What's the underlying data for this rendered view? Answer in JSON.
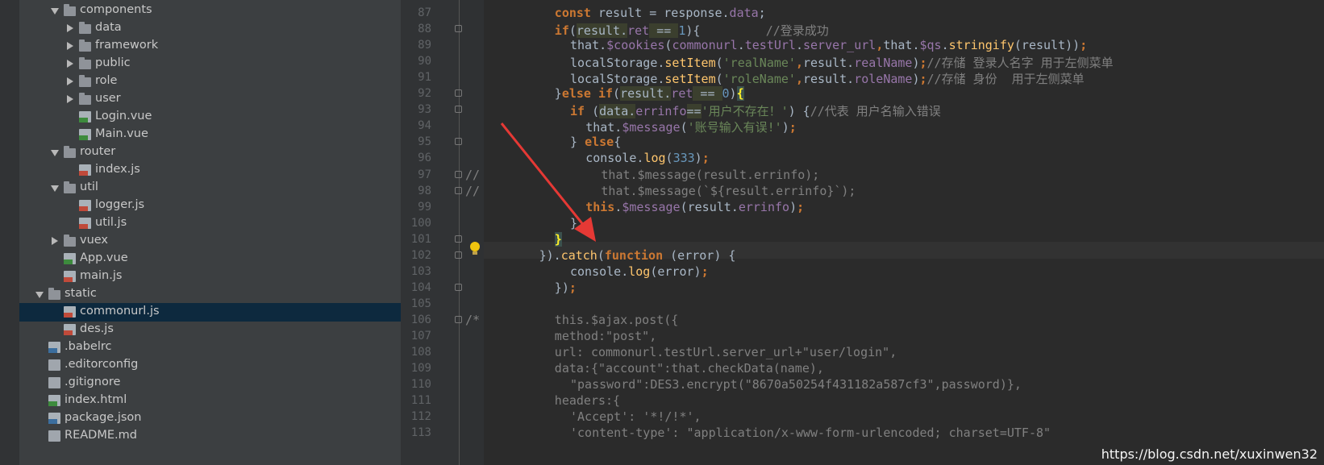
{
  "tree": {
    "items": [
      {
        "label": "components",
        "icon": "folder",
        "indent": 2,
        "expanded": true
      },
      {
        "label": "data",
        "icon": "folder",
        "indent": 3,
        "expanded": false
      },
      {
        "label": "framework",
        "icon": "folder",
        "indent": 3,
        "expanded": false
      },
      {
        "label": "public",
        "icon": "folder",
        "indent": 3,
        "expanded": false
      },
      {
        "label": "role",
        "icon": "folder",
        "indent": 3,
        "expanded": false
      },
      {
        "label": "user",
        "icon": "folder",
        "indent": 3,
        "expanded": false
      },
      {
        "label": "Login.vue",
        "icon": "vue",
        "indent": 3
      },
      {
        "label": "Main.vue",
        "icon": "vue",
        "indent": 3
      },
      {
        "label": "router",
        "icon": "folder",
        "indent": 2,
        "expanded": true
      },
      {
        "label": "index.js",
        "icon": "js",
        "indent": 3
      },
      {
        "label": "util",
        "icon": "folder",
        "indent": 2,
        "expanded": true
      },
      {
        "label": "logger.js",
        "icon": "js",
        "indent": 3
      },
      {
        "label": "util.js",
        "icon": "js",
        "indent": 3
      },
      {
        "label": "vuex",
        "icon": "folder",
        "indent": 2,
        "expanded": false
      },
      {
        "label": "App.vue",
        "icon": "vue",
        "indent": 2
      },
      {
        "label": "main.js",
        "icon": "js",
        "indent": 2
      },
      {
        "label": "static",
        "icon": "folder",
        "indent": 1,
        "expanded": true
      },
      {
        "label": "commonurl.js",
        "icon": "js",
        "indent": 2,
        "selected": true
      },
      {
        "label": "des.js",
        "icon": "js",
        "indent": 2
      },
      {
        "label": ".babelrc",
        "icon": "json",
        "indent": 1
      },
      {
        "label": ".editorconfig",
        "icon": "txt",
        "indent": 1
      },
      {
        "label": ".gitignore",
        "icon": "txt",
        "indent": 1
      },
      {
        "label": "index.html",
        "icon": "html",
        "indent": 1
      },
      {
        "label": "package.json",
        "icon": "json",
        "indent": 1
      },
      {
        "label": "README.md",
        "icon": "txt",
        "indent": 1
      }
    ]
  },
  "editor": {
    "lines": [
      {
        "n": "87",
        "fold": false,
        "prefix": "",
        "indent": 4,
        "tokens": [
          [
            "k",
            "const"
          ],
          [
            "t",
            " result = response."
          ],
          [
            "p",
            "data"
          ],
          [
            "t",
            ";"
          ]
        ]
      },
      {
        "n": "88",
        "fold": true,
        "prefix": "",
        "indent": 4,
        "tokens": [
          [
            "k",
            "if"
          ],
          [
            "t",
            "("
          ],
          [
            "hl",
            "result."
          ],
          [
            "p",
            "ret"
          ],
          [
            "hl",
            " == "
          ],
          [
            "n",
            "1"
          ],
          [
            "t",
            "){         "
          ],
          [
            "c",
            "//登录成功"
          ]
        ]
      },
      {
        "n": "89",
        "fold": false,
        "prefix": "",
        "indent": 5,
        "tokens": [
          [
            "t",
            "that."
          ],
          [
            "p",
            "$cookies"
          ],
          [
            "t",
            "("
          ],
          [
            "p",
            "commonurl"
          ],
          [
            "t",
            "."
          ],
          [
            "p",
            "testUrl"
          ],
          [
            "t",
            "."
          ],
          [
            "p",
            "server_url"
          ],
          [
            "k",
            ","
          ],
          [
            "t",
            "that."
          ],
          [
            "p",
            "$qs"
          ],
          [
            "t",
            "."
          ],
          [
            "f",
            "stringify"
          ],
          [
            "t",
            "(result))"
          ],
          [
            "k",
            ";"
          ]
        ]
      },
      {
        "n": "90",
        "fold": false,
        "prefix": "",
        "indent": 5,
        "tokens": [
          [
            "t",
            "localStorage."
          ],
          [
            "f",
            "setItem"
          ],
          [
            "t",
            "("
          ],
          [
            "s",
            "'realName'"
          ],
          [
            "k",
            ","
          ],
          [
            "t",
            "result."
          ],
          [
            "p",
            "realName"
          ],
          [
            "t",
            ")"
          ],
          [
            "k",
            ";"
          ],
          [
            "c",
            "//存储 登录人名字 用于左侧菜单"
          ]
        ]
      },
      {
        "n": "91",
        "fold": false,
        "prefix": "",
        "indent": 5,
        "tokens": [
          [
            "t",
            "localStorage."
          ],
          [
            "f",
            "setItem"
          ],
          [
            "t",
            "("
          ],
          [
            "s",
            "'roleName'"
          ],
          [
            "k",
            ","
          ],
          [
            "t",
            "result."
          ],
          [
            "p",
            "roleName"
          ],
          [
            "t",
            ")"
          ],
          [
            "k",
            ";"
          ],
          [
            "c",
            "//存储 身份  用于左侧菜单"
          ]
        ]
      },
      {
        "n": "92",
        "fold": true,
        "prefix": "",
        "indent": 4,
        "tokens": [
          [
            "t",
            "}"
          ],
          [
            "k",
            "else if"
          ],
          [
            "t",
            "("
          ],
          [
            "hl",
            "result."
          ],
          [
            "p",
            "ret"
          ],
          [
            "hl",
            " == "
          ],
          [
            "n",
            "0"
          ],
          [
            "t",
            ")"
          ],
          [
            "brace",
            "{"
          ]
        ]
      },
      {
        "n": "93",
        "fold": true,
        "prefix": "",
        "indent": 5,
        "tokens": [
          [
            "k",
            "if"
          ],
          [
            "t",
            " ("
          ],
          [
            "hl",
            "data."
          ],
          [
            "p",
            "errinfo"
          ],
          [
            "hl",
            "=="
          ],
          [
            "s",
            "'用户不存在！'"
          ],
          [
            "t",
            ") {"
          ],
          [
            "c",
            "//代表 用户名输入错误"
          ]
        ]
      },
      {
        "n": "94",
        "fold": false,
        "prefix": "",
        "indent": 6,
        "tokens": [
          [
            "t",
            "that."
          ],
          [
            "p",
            "$message"
          ],
          [
            "t",
            "("
          ],
          [
            "s",
            "'账号输入有误!'"
          ],
          [
            "t",
            ")"
          ],
          [
            "k",
            ";"
          ]
        ]
      },
      {
        "n": "95",
        "fold": true,
        "prefix": "",
        "indent": 5,
        "tokens": [
          [
            "t",
            "} "
          ],
          [
            "k",
            "else"
          ],
          [
            "t",
            "{"
          ]
        ]
      },
      {
        "n": "96",
        "fold": false,
        "prefix": "",
        "indent": 6,
        "tokens": [
          [
            "t",
            "console."
          ],
          [
            "f",
            "log"
          ],
          [
            "t",
            "("
          ],
          [
            "n",
            "333"
          ],
          [
            "t",
            ")"
          ],
          [
            "k",
            ";"
          ]
        ]
      },
      {
        "n": "97",
        "fold": true,
        "prefix": "//",
        "indent": 7,
        "tokens": [
          [
            "c",
            "that.$message(result.errinfo);"
          ]
        ]
      },
      {
        "n": "98",
        "fold": true,
        "prefix": "//",
        "indent": 7,
        "tokens": [
          [
            "c",
            "that.$message(`${result.errinfo}`);"
          ]
        ]
      },
      {
        "n": "99",
        "fold": false,
        "prefix": "",
        "indent": 6,
        "tokens": [
          [
            "k",
            "this"
          ],
          [
            "t",
            "."
          ],
          [
            "p",
            "$message"
          ],
          [
            "t",
            "(result."
          ],
          [
            "p",
            "errinfo"
          ],
          [
            "t",
            ")"
          ],
          [
            "k",
            ";"
          ]
        ]
      },
      {
        "n": "100",
        "fold": false,
        "prefix": "",
        "indent": 5,
        "tokens": [
          [
            "t",
            "}"
          ]
        ]
      },
      {
        "n": "101",
        "fold": true,
        "prefix": "",
        "indent": 4,
        "tokens": [
          [
            "brace",
            "}"
          ]
        ]
      },
      {
        "n": "102",
        "fold": true,
        "prefix": "",
        "indent": 3,
        "tokens": [
          [
            "t",
            "})."
          ],
          [
            "f",
            "catch"
          ],
          [
            "t",
            "("
          ],
          [
            "k",
            "function"
          ],
          [
            "t",
            " (error) {"
          ]
        ]
      },
      {
        "n": "103",
        "fold": false,
        "prefix": "",
        "indent": 5,
        "tokens": [
          [
            "t",
            "console."
          ],
          [
            "f",
            "log"
          ],
          [
            "t",
            "(error)"
          ],
          [
            "k",
            ";"
          ]
        ]
      },
      {
        "n": "104",
        "fold": true,
        "prefix": "",
        "indent": 4,
        "tokens": [
          [
            "t",
            "})"
          ],
          [
            "k",
            ";"
          ]
        ]
      },
      {
        "n": "105",
        "fold": false,
        "prefix": "",
        "indent": 0,
        "tokens": []
      },
      {
        "n": "106",
        "fold": true,
        "prefix": "/*",
        "indent": 4,
        "tokens": [
          [
            "c",
            "this.$ajax.post({"
          ]
        ]
      },
      {
        "n": "107",
        "fold": false,
        "prefix": "",
        "indent": 4,
        "tokens": [
          [
            "c",
            "method:\"post\","
          ]
        ]
      },
      {
        "n": "108",
        "fold": false,
        "prefix": "",
        "indent": 4,
        "tokens": [
          [
            "c",
            "url: commonurl.testUrl.server_url+\"user/login\","
          ]
        ]
      },
      {
        "n": "109",
        "fold": false,
        "prefix": "",
        "indent": 4,
        "tokens": [
          [
            "c",
            "data:{\"account\":that.checkData(name),"
          ]
        ]
      },
      {
        "n": "110",
        "fold": false,
        "prefix": "",
        "indent": 5,
        "tokens": [
          [
            "c",
            "\"password\":DES3.encrypt(\"8670a50254f431182a587cf3\",password)},"
          ]
        ]
      },
      {
        "n": "111",
        "fold": false,
        "prefix": "",
        "indent": 4,
        "tokens": [
          [
            "c",
            "headers:{"
          ]
        ]
      },
      {
        "n": "112",
        "fold": false,
        "prefix": "",
        "indent": 5,
        "tokens": [
          [
            "c",
            "'Accept': '*!/!*',"
          ]
        ]
      },
      {
        "n": "113",
        "fold": false,
        "prefix": "",
        "indent": 5,
        "tokens": [
          [
            "c",
            "'content-type': \"application/x-www-form-urlencoded; charset=UTF-8\""
          ]
        ]
      }
    ]
  },
  "watermark": "https://blog.csdn.net/xuxinwen32",
  "colors": {
    "keyword": "#cc7832",
    "string": "#6a8759",
    "number": "#6897bb",
    "comment": "#808080",
    "property": "#9876aa",
    "function": "#ffc66d"
  }
}
